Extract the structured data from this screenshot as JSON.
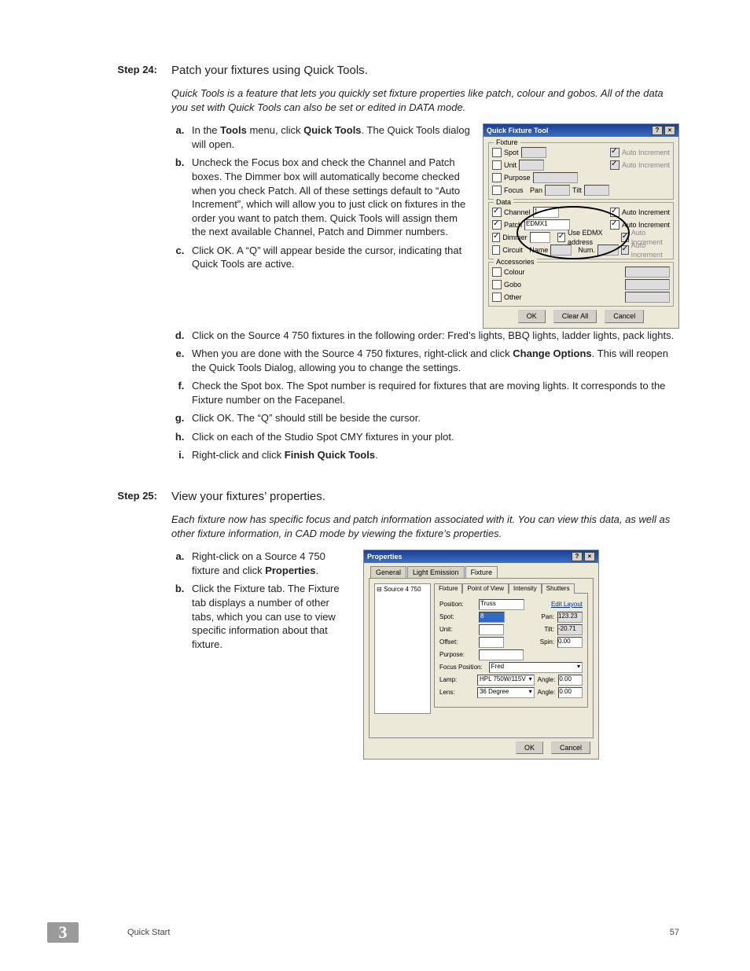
{
  "step24": {
    "label": "Step 24:",
    "title": "Patch your fixtures using Quick Tools.",
    "desc": "Quick Tools is a feature that lets you quickly set fixture properties like patch, colour and gobos. All of the data you set with Quick Tools can also be set or edited in DATA mode.",
    "a_pre": "In the ",
    "a_b1": "Tools",
    "a_mid": " menu, click ",
    "a_b2": "Quick Tools",
    "a_post": ". The Quick Tools dialog will open.",
    "b": "Uncheck the Focus box and check the Channel and Patch boxes. The Dimmer box will automatically become checked when you check Patch. All of these settings default to “Auto Increment”, which will allow you to just click on fixtures in the order you want to patch them. Quick Tools will assign them the next available Channel, Patch and Dimmer numbers.",
    "c": "Click OK. A “Q” will appear beside the cursor, indicating that Quick Tools are active.",
    "d": "Click on the Source 4 750 fixtures in the following order: Fred’s lights, BBQ lights, ladder lights, pack lights.",
    "e_pre": "When you are done with the Source 4 750 fixtures, right-click and click ",
    "e_b": "Change Options",
    "e_post": ". This will reopen the Quick Tools Dialog, allowing you to change the settings.",
    "f": "Check the Spot box. The Spot number is required for fixtures that are moving lights. It corresponds to the Fixture number on the Facepanel.",
    "g": "Click OK. The “Q” should still be beside the cursor.",
    "h": "Click on each of the Studio Spot CMY fixtures in your plot.",
    "i_pre": "Right-click and click ",
    "i_b": "Finish Quick Tools",
    "i_post": "."
  },
  "dlg1": {
    "title": "Quick Fixture Tool",
    "grp_fixture": "Fixture",
    "spot": "Spot",
    "unit": "Unit",
    "purpose": "Purpose",
    "focus": "Focus",
    "pan": "Pan",
    "tilt": "Tilt",
    "grp_data": "Data",
    "channel": "Channel",
    "patch": "Patch",
    "patch_val": "EDMX1",
    "dimmer": "Dimmer",
    "use_edmx": "Use EDMX address",
    "circuit": "Circuit",
    "name": "Name",
    "num": "Num.",
    "auto_inc": "Auto Increment",
    "grp_acc": "Accessories",
    "colour": "Colour",
    "gobo": "Gobo",
    "other": "Other",
    "ok": "OK",
    "clear": "Clear All",
    "cancel": "Cancel"
  },
  "step25": {
    "label": "Step 25:",
    "title": "View your fixtures’ properties.",
    "desc": "Each fixture now has specific focus and patch information associated with it. You can view this data, as well as other fixture information, in CAD mode by viewing the fixture’s properties.",
    "a_pre": "Right-click on a Source 4 750 fixture and click ",
    "a_b": "Properties",
    "a_post": ".",
    "b": "Click the Fixture tab. The Fixture tab displays a number of other tabs, which you can use to view specific information about that fixture."
  },
  "dlg2": {
    "title": "Properties",
    "tab_general": "General",
    "tab_light": "Light Emission",
    "tab_fixture": "Fixture",
    "tree_item": "Source 4 750",
    "st_fixture": "Fixture",
    "st_pov": "Point of View",
    "st_intensity": "Intensity",
    "st_shutters": "Shutters",
    "position": "Position:",
    "position_val": "Truss",
    "edit_layout": "Edit Layout",
    "spot": "Spot:",
    "spot_val": "8",
    "pan": "Pan:",
    "pan_val": "123.23",
    "unit": "Unit:",
    "tilt": "Tilt:",
    "tilt_val": "-20.71",
    "offset": "Offset:",
    "spin": "Spin:",
    "spin_val": "0.00",
    "purpose": "Purpose:",
    "focuspos": "Focus Position:",
    "focuspos_val": "Fred",
    "lamp": "Lamp:",
    "lamp_val": "HPL 750W/115V",
    "angle": "Angle:",
    "angle_val": "0.00",
    "lens": "Lens:",
    "lens_val": "36 Degree",
    "angle2_val": "0.00",
    "ok": "OK",
    "cancel": "Cancel"
  },
  "footer": {
    "chapter": "3",
    "section": "Quick Start",
    "page": "57"
  }
}
